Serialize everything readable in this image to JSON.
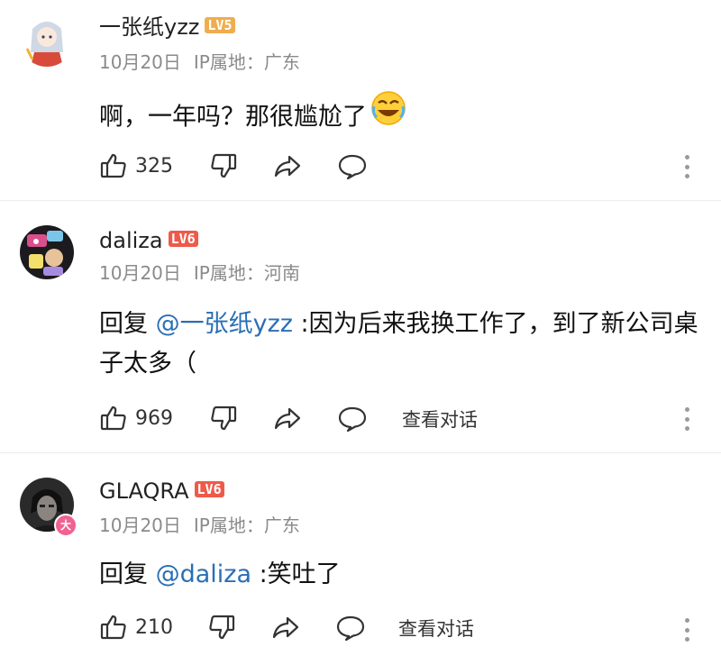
{
  "comments": [
    {
      "username": "一张纸yzz",
      "level": "LV5",
      "date": "10月20日",
      "ip": "IP属地：广东",
      "text": "啊，一年吗？那很尴尬了",
      "emoji": "laughing-crying-emoji",
      "likes": "325",
      "has_view_conversation": false,
      "avatar": "anime-girl-avatar"
    },
    {
      "username": "daliza",
      "level": "LV6",
      "date": "10月20日",
      "ip": "IP属地：河南",
      "reply_prefix": "回复 ",
      "mention": "@一张纸yzz",
      "text": " :因为后来我换工作了，到了新公司桌子太多（",
      "likes": "969",
      "view_conversation": "查看对话",
      "avatar": "sticker-collage-avatar"
    },
    {
      "username": "GLAQRA",
      "level": "LV6",
      "date": "10月20日",
      "ip": "IP属地：广东",
      "reply_prefix": "回复 ",
      "mention": "@daliza",
      "text": " :笑吐了",
      "likes": "210",
      "view_conversation": "查看对话",
      "avatar": "dark-portrait-avatar",
      "avatar_badge": "大"
    }
  ],
  "icons": [
    "thumb-up-icon",
    "thumb-down-icon",
    "share-icon",
    "comment-icon",
    "more-icon"
  ],
  "colors": {
    "mention": "#2a6fb5",
    "lv5": "#f0ad4e",
    "lv6": "#ee5a4a",
    "meta": "#8a8a8a",
    "avatar_badge": "#f06292"
  }
}
